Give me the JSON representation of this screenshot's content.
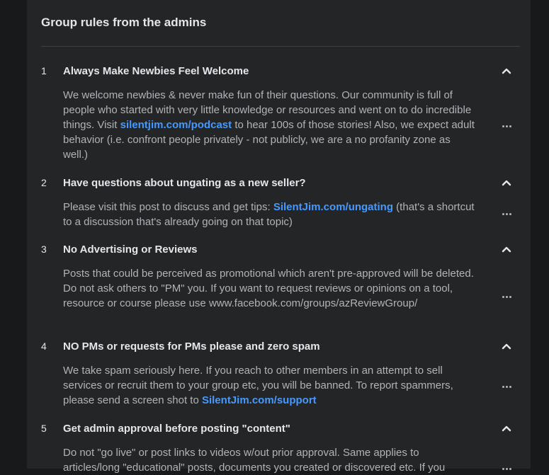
{
  "header": {
    "title": "Group rules from the admins"
  },
  "rules": [
    {
      "number": "1",
      "title": "Always Make Newbies Feel Welcome",
      "body_pre": "We welcome newbies & never make fun of their questions. Our community is full of people who started with very little knowledge or resources and went on to do incredible things. Visit ",
      "link": "silentjim.com/podcast",
      "body_post": " to hear 100s of those stories! Also, we expect adult behavior (i.e. confront people privately - not publicly, we are a no profanity zone as well.)"
    },
    {
      "number": "2",
      "title": "Have questions about ungating as a new seller?",
      "body_pre": "Please visit this post to discuss and get tips: ",
      "link": "SilentJim.com/ungating",
      "body_post": " (that's a shortcut to a discussion that's already going on that topic)"
    },
    {
      "number": "3",
      "title": "No Advertising or Reviews",
      "body_pre": "Posts that could be perceived as promotional which aren't pre-approved will be deleted. Do not ask others to \"PM\" you. If you want to request reviews or opinions on a tool, resource or course please use www.facebook.com/groups/azReviewGroup/",
      "link": "",
      "body_post": ""
    },
    {
      "number": "4",
      "title": "NO PMs or requests for PMs please and zero spam",
      "body_pre": "We take spam seriously here. If you reach to other members in an attempt to sell services or recruit them to your group etc, you will be banned. To report spammers, please send a screen shot to ",
      "link": "SilentJim.com/support",
      "body_post": ""
    },
    {
      "number": "5",
      "title": "Get admin approval before posting \"content\"",
      "body_pre": "Do not \"go live\" or post links to videos w/out prior approval. Same applies to articles/long \"educational\" posts, documents you created or discovered etc. If you",
      "link": "",
      "body_post": ""
    }
  ],
  "icons": {
    "collapse": "chevron-up-icon",
    "more": "more-options-icon"
  },
  "colors": {
    "background": "#18191a",
    "card": "#242526",
    "link": "#4599ff",
    "title": "#e4e6eb",
    "body": "#b0b3b8"
  }
}
